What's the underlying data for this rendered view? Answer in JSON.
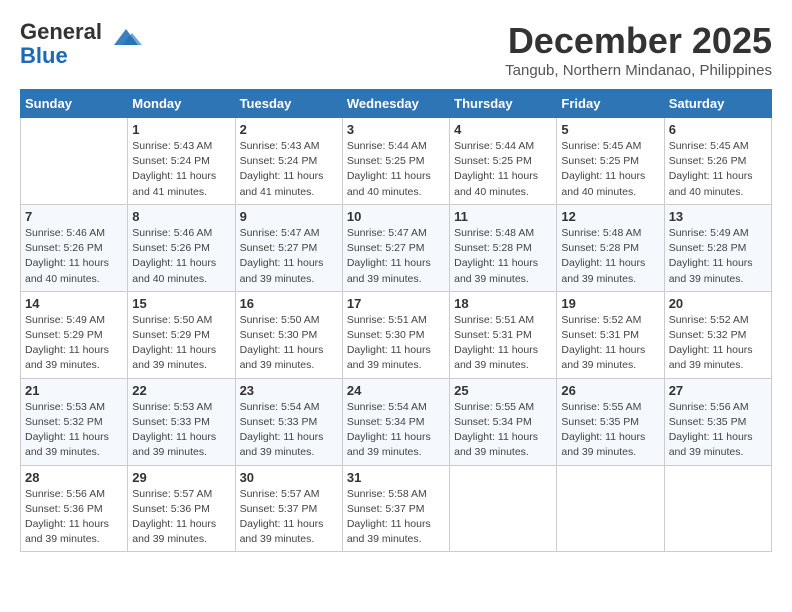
{
  "header": {
    "logo_general": "General",
    "logo_blue": "Blue",
    "month_title": "December 2025",
    "location": "Tangub, Northern Mindanao, Philippines"
  },
  "days_of_week": [
    "Sunday",
    "Monday",
    "Tuesday",
    "Wednesday",
    "Thursday",
    "Friday",
    "Saturday"
  ],
  "weeks": [
    [
      {
        "day": null
      },
      {
        "day": 1,
        "sunrise": "5:43 AM",
        "sunset": "5:24 PM",
        "daylight": "11 hours and 41 minutes."
      },
      {
        "day": 2,
        "sunrise": "5:43 AM",
        "sunset": "5:24 PM",
        "daylight": "11 hours and 41 minutes."
      },
      {
        "day": 3,
        "sunrise": "5:44 AM",
        "sunset": "5:25 PM",
        "daylight": "11 hours and 40 minutes."
      },
      {
        "day": 4,
        "sunrise": "5:44 AM",
        "sunset": "5:25 PM",
        "daylight": "11 hours and 40 minutes."
      },
      {
        "day": 5,
        "sunrise": "5:45 AM",
        "sunset": "5:25 PM",
        "daylight": "11 hours and 40 minutes."
      },
      {
        "day": 6,
        "sunrise": "5:45 AM",
        "sunset": "5:26 PM",
        "daylight": "11 hours and 40 minutes."
      }
    ],
    [
      {
        "day": 7,
        "sunrise": "5:46 AM",
        "sunset": "5:26 PM",
        "daylight": "11 hours and 40 minutes."
      },
      {
        "day": 8,
        "sunrise": "5:46 AM",
        "sunset": "5:26 PM",
        "daylight": "11 hours and 40 minutes."
      },
      {
        "day": 9,
        "sunrise": "5:47 AM",
        "sunset": "5:27 PM",
        "daylight": "11 hours and 39 minutes."
      },
      {
        "day": 10,
        "sunrise": "5:47 AM",
        "sunset": "5:27 PM",
        "daylight": "11 hours and 39 minutes."
      },
      {
        "day": 11,
        "sunrise": "5:48 AM",
        "sunset": "5:28 PM",
        "daylight": "11 hours and 39 minutes."
      },
      {
        "day": 12,
        "sunrise": "5:48 AM",
        "sunset": "5:28 PM",
        "daylight": "11 hours and 39 minutes."
      },
      {
        "day": 13,
        "sunrise": "5:49 AM",
        "sunset": "5:28 PM",
        "daylight": "11 hours and 39 minutes."
      }
    ],
    [
      {
        "day": 14,
        "sunrise": "5:49 AM",
        "sunset": "5:29 PM",
        "daylight": "11 hours and 39 minutes."
      },
      {
        "day": 15,
        "sunrise": "5:50 AM",
        "sunset": "5:29 PM",
        "daylight": "11 hours and 39 minutes."
      },
      {
        "day": 16,
        "sunrise": "5:50 AM",
        "sunset": "5:30 PM",
        "daylight": "11 hours and 39 minutes."
      },
      {
        "day": 17,
        "sunrise": "5:51 AM",
        "sunset": "5:30 PM",
        "daylight": "11 hours and 39 minutes."
      },
      {
        "day": 18,
        "sunrise": "5:51 AM",
        "sunset": "5:31 PM",
        "daylight": "11 hours and 39 minutes."
      },
      {
        "day": 19,
        "sunrise": "5:52 AM",
        "sunset": "5:31 PM",
        "daylight": "11 hours and 39 minutes."
      },
      {
        "day": 20,
        "sunrise": "5:52 AM",
        "sunset": "5:32 PM",
        "daylight": "11 hours and 39 minutes."
      }
    ],
    [
      {
        "day": 21,
        "sunrise": "5:53 AM",
        "sunset": "5:32 PM",
        "daylight": "11 hours and 39 minutes."
      },
      {
        "day": 22,
        "sunrise": "5:53 AM",
        "sunset": "5:33 PM",
        "daylight": "11 hours and 39 minutes."
      },
      {
        "day": 23,
        "sunrise": "5:54 AM",
        "sunset": "5:33 PM",
        "daylight": "11 hours and 39 minutes."
      },
      {
        "day": 24,
        "sunrise": "5:54 AM",
        "sunset": "5:34 PM",
        "daylight": "11 hours and 39 minutes."
      },
      {
        "day": 25,
        "sunrise": "5:55 AM",
        "sunset": "5:34 PM",
        "daylight": "11 hours and 39 minutes."
      },
      {
        "day": 26,
        "sunrise": "5:55 AM",
        "sunset": "5:35 PM",
        "daylight": "11 hours and 39 minutes."
      },
      {
        "day": 27,
        "sunrise": "5:56 AM",
        "sunset": "5:35 PM",
        "daylight": "11 hours and 39 minutes."
      }
    ],
    [
      {
        "day": 28,
        "sunrise": "5:56 AM",
        "sunset": "5:36 PM",
        "daylight": "11 hours and 39 minutes."
      },
      {
        "day": 29,
        "sunrise": "5:57 AM",
        "sunset": "5:36 PM",
        "daylight": "11 hours and 39 minutes."
      },
      {
        "day": 30,
        "sunrise": "5:57 AM",
        "sunset": "5:37 PM",
        "daylight": "11 hours and 39 minutes."
      },
      {
        "day": 31,
        "sunrise": "5:58 AM",
        "sunset": "5:37 PM",
        "daylight": "11 hours and 39 minutes."
      },
      {
        "day": null
      },
      {
        "day": null
      },
      {
        "day": null
      }
    ]
  ]
}
